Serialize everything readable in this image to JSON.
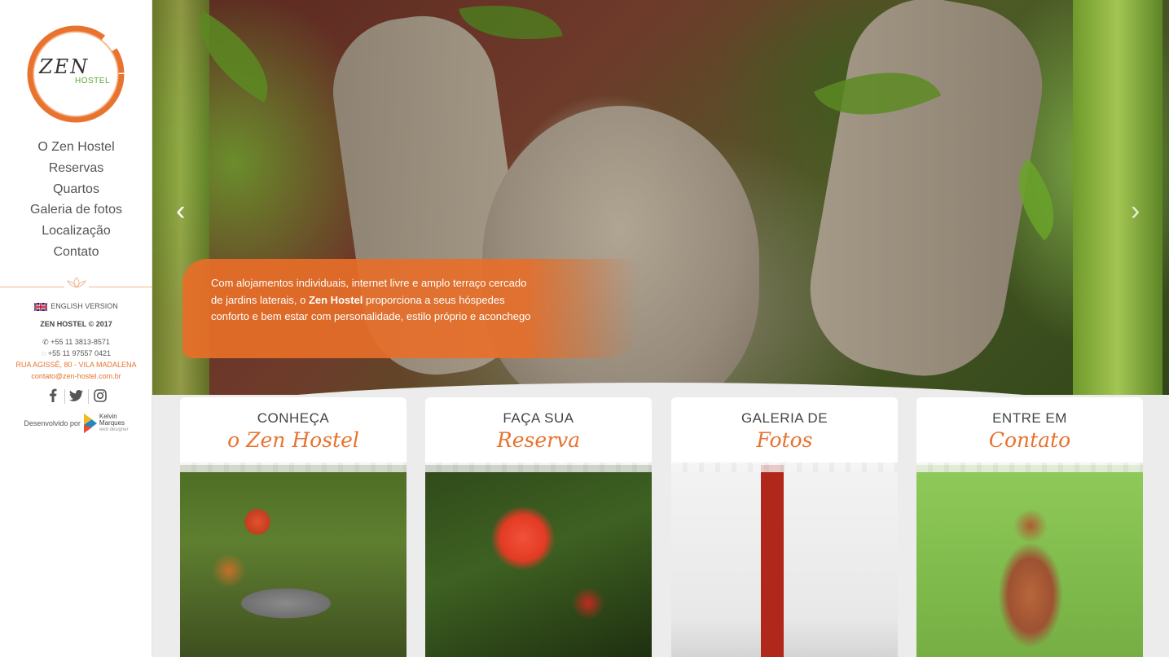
{
  "brand": {
    "name_main": "ZEN",
    "name_sub": "HOSTEL",
    "accent_color": "#e8732f",
    "green_color": "#5aa832"
  },
  "nav": [
    {
      "label": "O Zen Hostel"
    },
    {
      "label": "Reservas"
    },
    {
      "label": "Quartos"
    },
    {
      "label": "Galeria de fotos"
    },
    {
      "label": "Localização"
    },
    {
      "label": "Contato"
    }
  ],
  "sidebar": {
    "language_link": "ENGLISH VERSION",
    "copyright": "ZEN HOSTEL © 2017",
    "phone": "+55 11 3813-8571",
    "whatsapp": "+55 11 97557 0421",
    "address": "RUA AGISSÊ, 80 - VILA MADALENA",
    "email": "contato@zen-hostel.com.br",
    "socials": [
      "facebook-icon",
      "twitter-icon",
      "instagram-icon"
    ],
    "developer_label": "Desenvolvido por",
    "developer_name_1": "Kelvin",
    "developer_name_2": "Marques",
    "developer_role": "web designer"
  },
  "hero": {
    "caption_before": "Com alojamentos individuais, internet livre e amplo terraço cercado de jardins laterais, o ",
    "caption_bold": "Zen Hostel",
    "caption_after": " proporciona a seus hóspedes conforto e bem estar com personalidade, estilo próprio e aconchego",
    "prev_arrow": "‹",
    "next_arrow": "›"
  },
  "cards": [
    {
      "title_top": "CONHEÇA",
      "title_script": "o Zen Hostel"
    },
    {
      "title_top": "FAÇA SUA",
      "title_script": "Reserva"
    },
    {
      "title_top": "GALERIA DE",
      "title_script": "Fotos"
    },
    {
      "title_top": "ENTRE EM",
      "title_script": "Contato"
    }
  ]
}
